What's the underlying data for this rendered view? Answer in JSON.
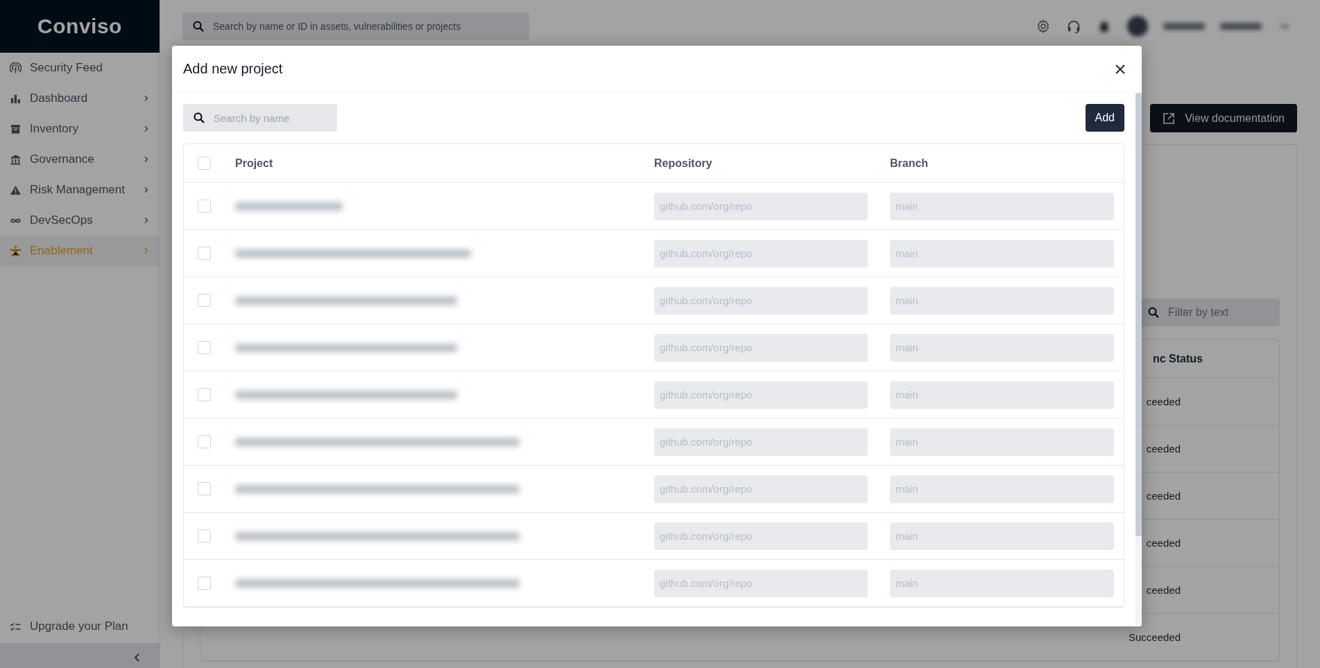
{
  "sidebar": {
    "logo": "Conviso",
    "items": [
      {
        "label": "Security Feed",
        "kind": "feed",
        "expandable": false,
        "selected": false
      },
      {
        "label": "Dashboard",
        "kind": "chart",
        "expandable": true,
        "selected": false
      },
      {
        "label": "Inventory",
        "kind": "archive",
        "expandable": true,
        "selected": false
      },
      {
        "label": "Governance",
        "kind": "bank",
        "expandable": true,
        "selected": false
      },
      {
        "label": "Risk Management",
        "kind": "warning",
        "expandable": true,
        "selected": false
      },
      {
        "label": "DevSecOps",
        "kind": "infinity",
        "expandable": true,
        "selected": false
      },
      {
        "label": "Enablement",
        "kind": "network",
        "expandable": true,
        "selected": true
      }
    ],
    "footer_item": {
      "label": "Upgrade your Plan"
    }
  },
  "topbar": {
    "search": {
      "placeholder": "Search by name or ID in assets, vulnerabilities or projects"
    }
  },
  "page": {
    "action_button": "View documentation",
    "filter": {
      "placeholder": "Filter by text"
    },
    "table": {
      "column": "nc Status",
      "rows": [
        "ceeded",
        "ceeded",
        "ceeded",
        "ceeded",
        "ceeded",
        "Succeeded"
      ]
    }
  },
  "modal": {
    "title": "Add new project",
    "search": {
      "placeholder": "Search by name"
    },
    "add_button": "Add",
    "table": {
      "select_all_checked": false,
      "columns": [
        "Project",
        "Repository",
        "Branch"
      ],
      "rows": [
        {
          "checked": false,
          "repository_placeholder": "github.com/org/repo",
          "branch_placeholder": "main"
        },
        {
          "checked": false,
          "repository_placeholder": "github.com/org/repo",
          "branch_placeholder": "main"
        },
        {
          "checked": false,
          "repository_placeholder": "github.com/org/repo",
          "branch_placeholder": "main"
        },
        {
          "checked": false,
          "repository_placeholder": "github.com/org/repo",
          "branch_placeholder": "main"
        },
        {
          "checked": false,
          "repository_placeholder": "github.com/org/repo",
          "branch_placeholder": "main"
        },
        {
          "checked": false,
          "repository_placeholder": "github.com/org/repo",
          "branch_placeholder": "main"
        },
        {
          "checked": false,
          "repository_placeholder": "github.com/org/repo",
          "branch_placeholder": "main"
        },
        {
          "checked": false,
          "repository_placeholder": "github.com/org/repo",
          "branch_placeholder": "main"
        },
        {
          "checked": false,
          "repository_placeholder": "github.com/org/repo",
          "branch_placeholder": "main"
        }
      ]
    }
  }
}
